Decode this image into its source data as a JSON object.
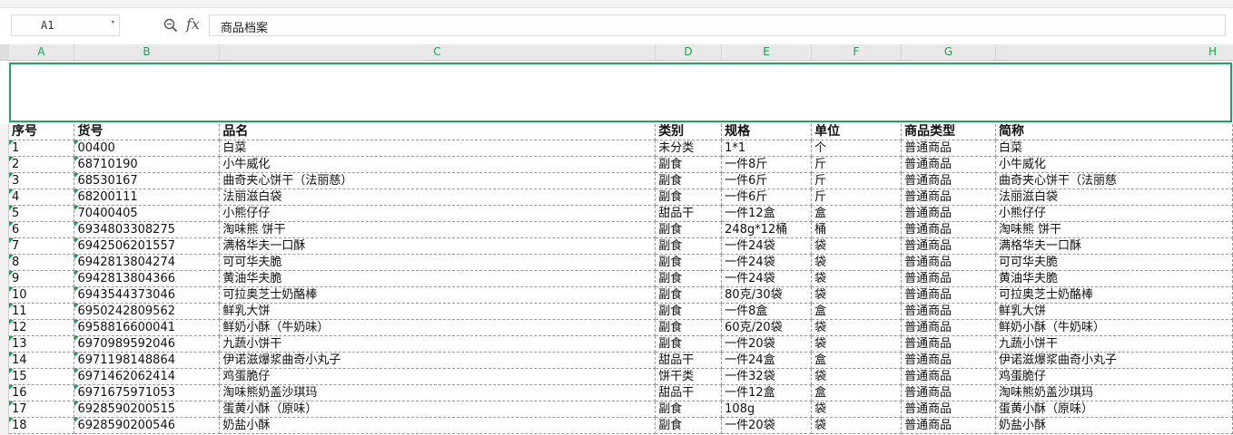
{
  "formula_bar": {
    "cell_ref": "A1",
    "formula_value": "商品档案",
    "icons": [
      "zoom-icon",
      "fx-icon"
    ],
    "fx_label": "fx"
  },
  "columns": [
    "A",
    "B",
    "C",
    "D",
    "E",
    "F",
    "G",
    "H"
  ],
  "table": {
    "headers": [
      "序号",
      "货号",
      "品名",
      "类别",
      "规格",
      "单位",
      "商品类型",
      "简称"
    ],
    "rows": [
      [
        "1",
        "00400",
        "白菜",
        "未分类",
        "1*1",
        "个",
        "普通商品",
        "白菜"
      ],
      [
        "2",
        "68710190",
        "小牛威化",
        "副食",
        "一件8斤",
        "斤",
        "普通商品",
        "小牛威化"
      ],
      [
        "3",
        "68530167",
        "曲奇夹心饼干（法丽慈）",
        "副食",
        "一件6斤",
        "斤",
        "普通商品",
        "曲奇夹心饼干（法丽慈"
      ],
      [
        "4",
        "68200111",
        "法丽滋白袋",
        "副食",
        "一件6斤",
        "斤",
        "普通商品",
        "法丽滋白袋"
      ],
      [
        "5",
        "70400405",
        "小熊仔仔",
        "甜品干",
        "一件12盒",
        "盒",
        "普通商品",
        "小熊仔仔"
      ],
      [
        "6",
        "6934803308275",
        "淘味熊 饼干",
        "副食",
        "248g*12桶",
        "桶",
        "普通商品",
        "淘味熊 饼干"
      ],
      [
        "7",
        "6942506201557",
        "满格华夫一口酥",
        "副食",
        "一件24袋",
        "袋",
        "普通商品",
        "满格华夫一口酥"
      ],
      [
        "8",
        "6942813804274",
        "可可华夫脆",
        "副食",
        "一件24袋",
        "袋",
        "普通商品",
        "可可华夫脆"
      ],
      [
        "9",
        "6942813804366",
        "黄油华夫脆",
        "副食",
        "一件24袋",
        "袋",
        "普通商品",
        "黄油华夫脆"
      ],
      [
        "10",
        "6943544373046",
        "可拉奥芝士奶酪棒",
        "副食",
        "80克/30袋",
        "袋",
        "普通商品",
        "可拉奥芝士奶酪棒"
      ],
      [
        "11",
        "6950242809562",
        "鲜乳大饼",
        "副食",
        "一件8盒",
        "盒",
        "普通商品",
        "鲜乳大饼"
      ],
      [
        "12",
        "6958816600041",
        "鲜奶小酥（牛奶味）",
        "副食",
        "60克/20袋",
        "袋",
        "普通商品",
        "鲜奶小酥（牛奶味）"
      ],
      [
        "13",
        "6970989592046",
        "九蔬小饼干",
        "副食",
        "一件20袋",
        "袋",
        "普通商品",
        "九蔬小饼干"
      ],
      [
        "14",
        "6971198148864",
        "伊诺滋爆浆曲奇小丸子",
        "甜品干",
        "一件24盒",
        "盒",
        "普通商品",
        "伊诺滋爆浆曲奇小丸子"
      ],
      [
        "15",
        "6971462062414",
        "鸡蛋脆仔",
        "饼干类",
        "一件32袋",
        "袋",
        "普通商品",
        "鸡蛋脆仔"
      ],
      [
        "16",
        "6971675971053",
        "淘味熊奶盖沙琪玛",
        "甜品干",
        "一件12盒",
        "盒",
        "普通商品",
        "淘味熊奶盖沙琪玛"
      ],
      [
        "17",
        "6928590200515",
        "蛋黄小酥（原味）",
        "副食",
        "108g",
        "袋",
        "普通商品",
        "蛋黄小酥（原味）"
      ],
      [
        "18",
        "6928590200546",
        "奶盐小酥",
        "副食",
        "一件20袋",
        "袋",
        "普通商品",
        "奶盐小酥"
      ]
    ]
  },
  "colors": {
    "accent": "#21a366",
    "header_text": "#1e9e50"
  }
}
